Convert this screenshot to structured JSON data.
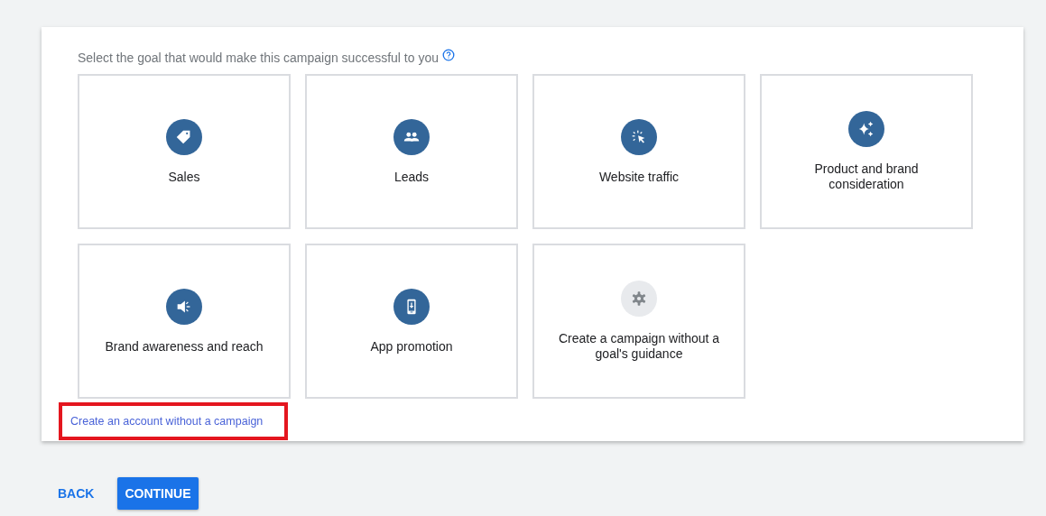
{
  "heading": "Select the goal that would make this campaign successful to you",
  "goals": [
    {
      "label": "Sales",
      "kind": "goal"
    },
    {
      "label": "Leads",
      "kind": "goal"
    },
    {
      "label": "Website traffic",
      "kind": "goal"
    },
    {
      "label": "Product and brand consideration",
      "kind": "goal"
    },
    {
      "label": "Brand awareness and reach",
      "kind": "goal"
    },
    {
      "label": "App promotion",
      "kind": "goal"
    },
    {
      "label": "Create a campaign without a goal's guidance",
      "kind": "custom"
    }
  ],
  "link": "Create an account without a campaign",
  "buttons": [
    {
      "label": "BACK",
      "kind": "text"
    },
    {
      "label": "CONTINUE",
      "kind": "primary"
    }
  ]
}
